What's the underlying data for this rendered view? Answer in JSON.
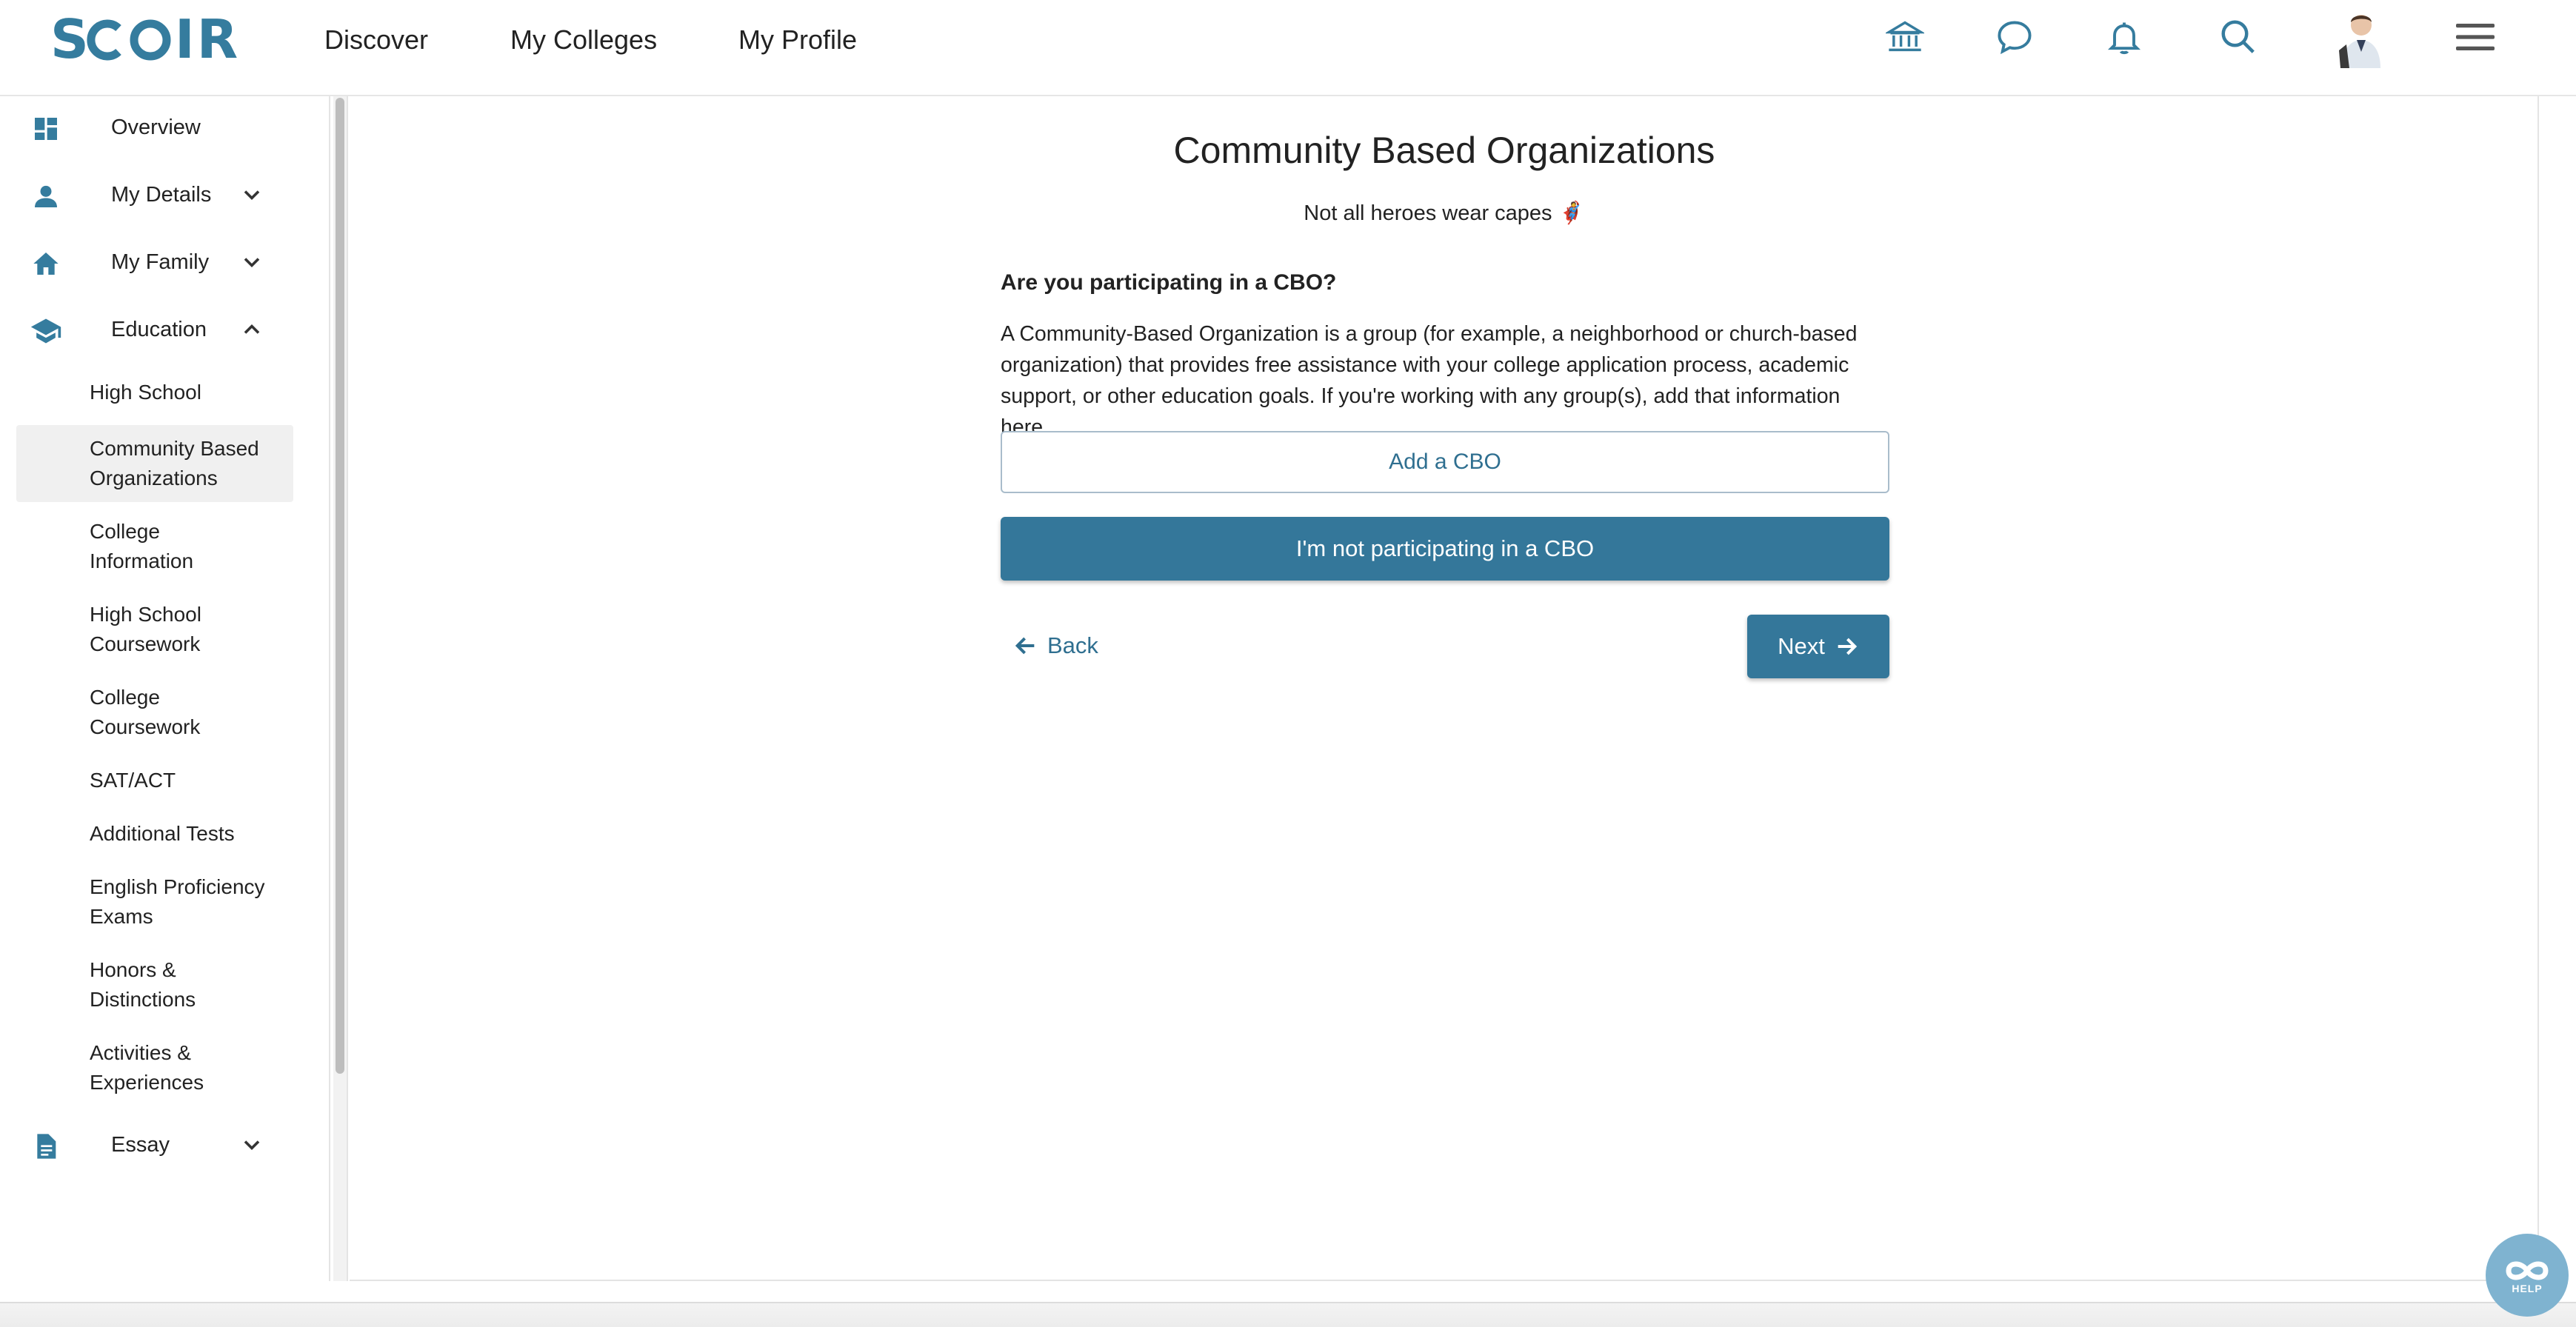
{
  "brand": {
    "logo_text": "SCOIR",
    "accent_color": "#357c9e",
    "primary_button_color": "#34779a"
  },
  "top_nav": {
    "links": [
      "Discover",
      "My Colleges",
      "My Profile"
    ],
    "icons": [
      "institution-icon",
      "chat-icon",
      "bell-icon",
      "search-icon",
      "avatar",
      "hamburger-menu-icon"
    ]
  },
  "sidebar": {
    "items": [
      {
        "label": "Overview",
        "icon": "dashboard-icon"
      },
      {
        "label": "My Details",
        "icon": "person-icon",
        "expanded": false
      },
      {
        "label": "My Family",
        "icon": "home-icon",
        "expanded": false
      },
      {
        "label": "Education",
        "icon": "graduation-cap-icon",
        "expanded": true
      },
      {
        "label": "Essay",
        "icon": "document-icon",
        "expanded": false
      }
    ],
    "education_sub": [
      "High School",
      "Community Based Organizations",
      "College Information",
      "High School Coursework",
      "College Coursework",
      "SAT/ACT",
      "Additional Tests",
      "English Proficiency Exams",
      "Honors & Distinctions",
      "Activities & Experiences"
    ],
    "active_sub": "Community Based Organizations"
  },
  "main": {
    "title": "Community Based Organizations",
    "subtitle": "Not all heroes wear capes 🦸",
    "question": "Are you participating in a CBO?",
    "description": "A Community-Based Organization is a group (for example, a neighborhood or church-based organization) that provides free assistance with your college application process, academic support, or other education goals. If you're working with any group(s), add that information here.",
    "add_button": "Add a CBO",
    "not_participating_button": "I'm not participating in a CBO",
    "back_label": "Back",
    "next_label": "Next"
  },
  "help": {
    "label": "HELP"
  }
}
